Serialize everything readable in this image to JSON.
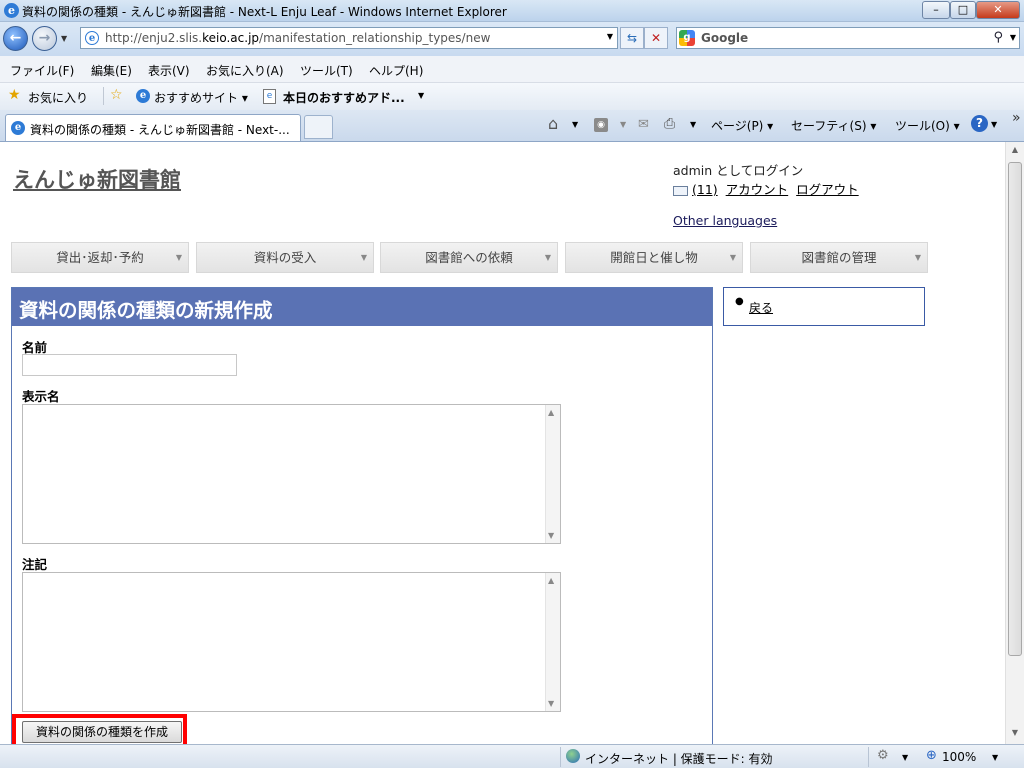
{
  "browser": {
    "window_title": "資料の関係の種類 - えんじゅ新図書館 - Next-L Enju Leaf - Windows Internet Explorer",
    "window_buttons": [
      "–",
      "□",
      "✕"
    ],
    "address": {
      "url_prefix": "http://enju2.slis.",
      "url_domain": "keio.ac.jp",
      "url_path": "/manifestation_relationship_types/new"
    },
    "search_provider": "Google",
    "menus": [
      "ファイル(F)",
      "編集(E)",
      "表示(V)",
      "お気に入り(A)",
      "ツール(T)",
      "ヘルプ(H)"
    ],
    "favorites": {
      "label": "お気に入り",
      "items": [
        "おすすめサイト ▾",
        "本日のおすすめアド..."
      ]
    },
    "tab_title": "資料の関係の種類 - えんじゅ新図書館 - Next-...",
    "commands": [
      "ページ(P) ▾",
      "セーフティ(S) ▾",
      "ツール(O) ▾"
    ],
    "status": {
      "zone": "インターネット | 保護モード: 有効",
      "zoom": "100%"
    }
  },
  "site": {
    "name": "えんじゅ新図書館"
  },
  "header": {
    "login_text": "admin としてログイン",
    "messages_count": "(11)",
    "account_link": "アカウント",
    "logout_link": "ログアウト",
    "other_languages": "Other languages"
  },
  "nav": [
    "貸出･返却･予約",
    "資料の受入",
    "図書館への依頼",
    "開館日と催し物",
    "図書館の管理"
  ],
  "form": {
    "title": "資料の関係の種類の新規作成",
    "name_label": "名前",
    "display_name_label": "表示名",
    "note_label": "注記",
    "submit_label": "資料の関係の種類を作成"
  },
  "sidebar": {
    "back_link": "戻る"
  },
  "colors": {
    "panel_header": "#5a72b4",
    "highlight": "#ff0000"
  }
}
